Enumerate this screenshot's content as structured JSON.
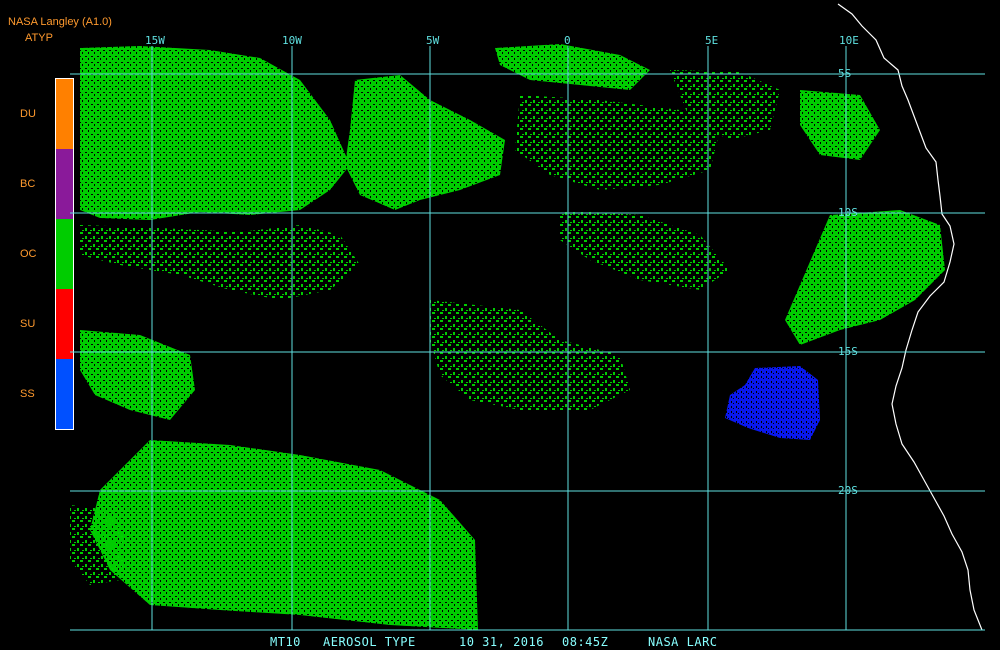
{
  "header": {
    "title": "NASA Langley (A1.0)",
    "product": "ATYP"
  },
  "legend": {
    "categories": [
      {
        "label": "DU",
        "color": "#ff8000"
      },
      {
        "label": "BC",
        "color": "#8a1a9a"
      },
      {
        "label": "OC",
        "color": "#00cc00"
      },
      {
        "label": "SU",
        "color": "#ff0000"
      },
      {
        "label": "SS",
        "color": "#0050ff"
      }
    ]
  },
  "grid": {
    "color": "#5fe0e0",
    "longitude_labels": [
      "15W",
      "10W",
      "5W",
      "0",
      "5E",
      "10E"
    ],
    "latitude_labels": [
      "5S",
      "10S",
      "15S",
      "20S"
    ]
  },
  "footer": {
    "satellite": "MT10",
    "product_name": "AEROSOL TYPE",
    "date": "10 31, 2016",
    "time": "08:45Z",
    "source": "NASA LARC"
  },
  "colors": {
    "background": "#000000",
    "coast": "#ffffff",
    "text": "#ff9a2e"
  }
}
